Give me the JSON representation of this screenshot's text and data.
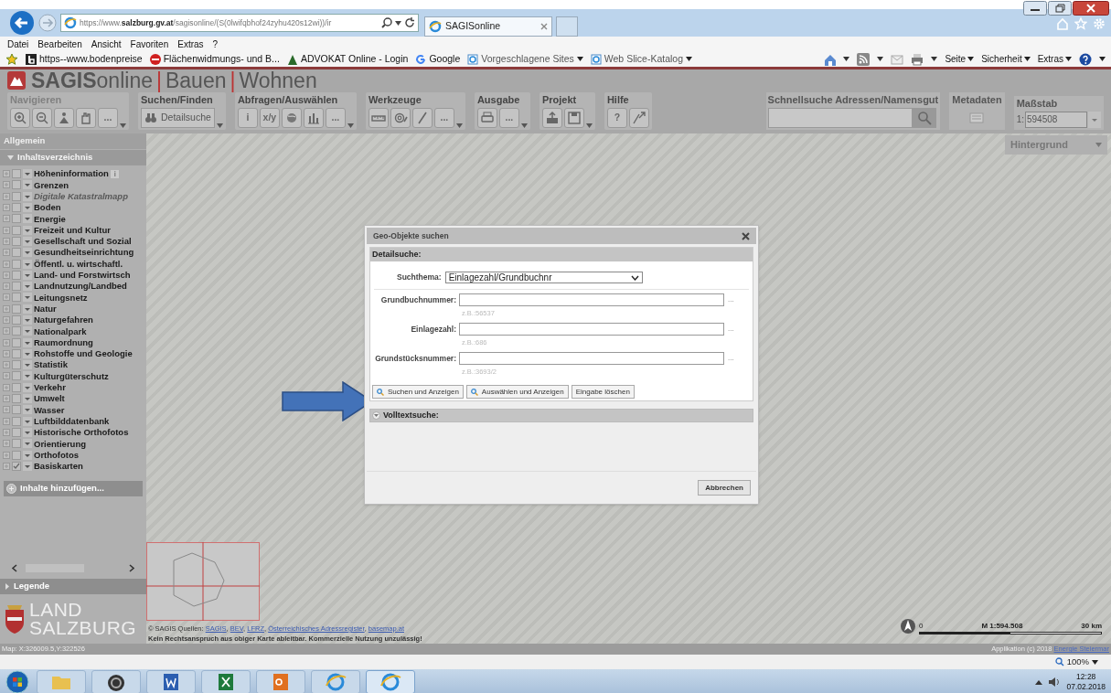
{
  "browser": {
    "address": "https://www.**salzburg.gv.at**/sagisonline/(S(0lwifqbhof24zyhu420s12wi))/ir",
    "tab_title": "SAGISonline",
    "menu": [
      "Datei",
      "Bearbeiten",
      "Ansicht",
      "Favoriten",
      "Extras",
      "?"
    ],
    "favorites": [
      {
        "label": "https--www.bodenpreise",
        "dropdown": false
      },
      {
        "label": "Flächenwidmungs- und B...",
        "dropdown": false
      },
      {
        "label": "ADVOKAT Online - Login",
        "dropdown": false
      },
      {
        "label": "Google",
        "dropdown": false
      },
      {
        "label": "Vorgeschlagene Sites",
        "dropdown": true
      },
      {
        "label": "Web Slice-Katalog",
        "dropdown": true
      }
    ],
    "commands": [
      "Seite",
      "Sicherheit",
      "Extras"
    ]
  },
  "app": {
    "brand": "SAGIS",
    "brand_suffix": "online",
    "sections": [
      {
        "separator": "|",
        "label": "Bauen"
      },
      {
        "separator": "|",
        "label": "Wohnen"
      }
    ],
    "toolbar": [
      {
        "label": "Navigieren",
        "disabled": true,
        "buttons": [
          {
            "kind": "icon"
          },
          {
            "kind": "icon"
          },
          {
            "kind": "icon"
          },
          {
            "kind": "icon"
          },
          {
            "kind": "text",
            "text": "..."
          }
        ]
      },
      {
        "label": "Suchen/Finden",
        "disabled": false,
        "buttons": [
          {
            "kind": "wide",
            "text": "Detailsuche"
          }
        ]
      },
      {
        "label": "Abfragen/Auswählen",
        "disabled": false,
        "buttons": [
          {
            "kind": "text",
            "text": "i"
          },
          {
            "kind": "text",
            "text": "x/y"
          },
          {
            "kind": "icon"
          },
          {
            "kind": "icon"
          },
          {
            "kind": "text",
            "text": "..."
          }
        ]
      },
      {
        "label": "Werkzeuge",
        "disabled": false,
        "buttons": [
          {
            "kind": "icon"
          },
          {
            "kind": "icon"
          },
          {
            "kind": "icon"
          },
          {
            "kind": "text",
            "text": "..."
          }
        ]
      },
      {
        "label": "Ausgabe",
        "disabled": false,
        "buttons": [
          {
            "kind": "icon"
          },
          {
            "kind": "text",
            "text": "..."
          }
        ]
      },
      {
        "label": "Projekt",
        "disabled": false,
        "buttons": [
          {
            "kind": "icon"
          },
          {
            "kind": "icon"
          }
        ]
      },
      {
        "label": "Hilfe",
        "disabled": false,
        "buttons": [
          {
            "kind": "text",
            "text": "?"
          },
          {
            "kind": "icon"
          }
        ]
      }
    ],
    "quick_search": {
      "label": "Schnellsuche Adressen/Namensgut"
    },
    "metadata": {
      "label": "Metadaten"
    },
    "scale": {
      "label": "Maßstab",
      "prefix": "1:",
      "value": "594508"
    }
  },
  "sidebar": {
    "general": "Allgemein",
    "toc": {
      "label": "Inhaltsverzeichnis",
      "expanded": true
    },
    "layers": [
      {
        "name": "Höheninformation",
        "checked": false,
        "disabled": false,
        "info": true
      },
      {
        "name": "Grenzen",
        "checked": false,
        "disabled": false,
        "info": false
      },
      {
        "name": "Digitale Katastralmapp",
        "checked": false,
        "disabled": true,
        "info": false
      },
      {
        "name": "Boden",
        "checked": false,
        "disabled": false,
        "info": false
      },
      {
        "name": "Energie",
        "checked": false,
        "disabled": false,
        "info": false
      },
      {
        "name": "Freizeit und Kultur",
        "checked": false,
        "disabled": false,
        "info": false
      },
      {
        "name": "Gesellschaft und Sozial",
        "checked": false,
        "disabled": false,
        "info": false
      },
      {
        "name": "Gesundheitseinrichtung",
        "checked": false,
        "disabled": false,
        "info": false
      },
      {
        "name": "Öffentl. u. wirtschaftl.",
        "checked": false,
        "disabled": false,
        "info": false
      },
      {
        "name": "Land- und Forstwirtsch",
        "checked": false,
        "disabled": false,
        "info": false
      },
      {
        "name": "Landnutzung/Landbed",
        "checked": false,
        "disabled": false,
        "info": false
      },
      {
        "name": "Leitungsnetz",
        "checked": false,
        "disabled": false,
        "info": false
      },
      {
        "name": "Natur",
        "checked": false,
        "disabled": false,
        "info": false
      },
      {
        "name": "Naturgefahren",
        "checked": false,
        "disabled": false,
        "info": false
      },
      {
        "name": "Nationalpark",
        "checked": false,
        "disabled": false,
        "info": false
      },
      {
        "name": "Raumordnung",
        "checked": false,
        "disabled": false,
        "info": false
      },
      {
        "name": "Rohstoffe und Geologie",
        "checked": false,
        "disabled": false,
        "info": false
      },
      {
        "name": "Statistik",
        "checked": false,
        "disabled": false,
        "info": false
      },
      {
        "name": "Kulturgüterschutz",
        "checked": false,
        "disabled": false,
        "info": false
      },
      {
        "name": "Verkehr",
        "checked": false,
        "disabled": false,
        "info": false
      },
      {
        "name": "Umwelt",
        "checked": false,
        "disabled": false,
        "info": false
      },
      {
        "name": "Wasser",
        "checked": false,
        "disabled": false,
        "info": false
      },
      {
        "name": "Luftbilddatenbank",
        "checked": false,
        "disabled": false,
        "info": false
      },
      {
        "name": "Historische Orthofotos",
        "checked": false,
        "disabled": false,
        "info": false
      },
      {
        "name": "Orientierung",
        "checked": false,
        "disabled": false,
        "info": false
      },
      {
        "name": "Orthofotos",
        "checked": false,
        "disabled": false,
        "info": false
      },
      {
        "name": "Basiskarten",
        "checked": true,
        "disabled": false,
        "info": false
      }
    ],
    "add_content": "Inhalte hinzufügen...",
    "legend": {
      "label": "Legende",
      "expanded": false
    },
    "logo": [
      "LAND",
      "SALZBURG"
    ]
  },
  "map": {
    "background_label": "Hintergrund",
    "scale_zero": "0",
    "scale_text": "M 1:594.508",
    "scale_end": "30 km",
    "credits": [
      {
        "text": "© SAGIS Quellen: ",
        "link": false
      },
      {
        "text": "SAGIS",
        "link": true
      },
      {
        "text": ", ",
        "link": false
      },
      {
        "text": "BEV",
        "link": true
      },
      {
        "text": ", ",
        "link": false
      },
      {
        "text": "LFRZ",
        "link": true
      },
      {
        "text": ", ",
        "link": false
      },
      {
        "text": "Österreichisches Adressregister",
        "link": true
      },
      {
        "text": ", ",
        "link": false
      },
      {
        "text": "basemap.at",
        "link": true
      }
    ],
    "disclaimer": "Kein Rechtsanspruch aus obiger Karte ableitbar. Kommerzielle Nutzung unzulässig!"
  },
  "dialog": {
    "title": "Geo-Objekte suchen",
    "detail": {
      "label": "Detailsuche:",
      "expanded": true
    },
    "topic_label": "Suchthema:",
    "topic_value": "Einlagezahl/Grundbuchnr",
    "fields": [
      {
        "label": "Grundbuchnummer:",
        "hint": "z.B.:56537",
        "more": "..."
      },
      {
        "label": "Einlagezahl:",
        "hint": "z.B.:686",
        "more": "..."
      },
      {
        "label": "Grundstücksnummer:",
        "hint": "z.B.:3693/2",
        "more": "..."
      }
    ],
    "buttons": [
      {
        "label": "Suchen und Anzeigen",
        "icon": true
      },
      {
        "label": "Auswählen und Anzeigen",
        "icon": true
      },
      {
        "label": "Eingabe löschen",
        "icon": false
      }
    ],
    "fulltext": {
      "label": "Volltextsuche:",
      "expanded": false
    },
    "cancel": "Abbrechen"
  },
  "status_bar": {
    "coords": "Map: X:326009.5,Y:322526",
    "copyright": "Applikation (c) 2018 ",
    "copyright_link": "Energie Steiermar"
  },
  "ie_status": {
    "zoom": "100%"
  },
  "taskbar": {
    "time": "12:28",
    "date": "07.02.2018"
  }
}
